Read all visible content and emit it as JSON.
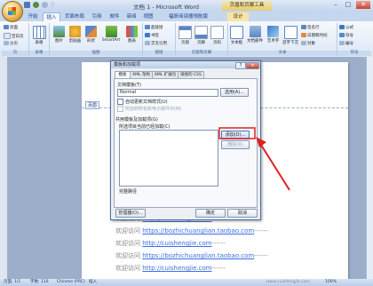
{
  "window": {
    "title": "文档 1 - Microsoft Word",
    "context_tool": "页眉和页脚工具",
    "minimize": "–",
    "maximize": "□",
    "close": "✕"
  },
  "tabs": [
    "开始",
    "插入",
    "页面布局",
    "引用",
    "邮件",
    "审阅",
    "视图",
    "福昕阅读器领航版",
    "设计"
  ],
  "ribbon": {
    "pages": {
      "label": "页",
      "items": [
        "封面",
        "空白页",
        "分页"
      ]
    },
    "table": {
      "label": "表格",
      "button": "表格"
    },
    "illustrations": {
      "label": "插图",
      "buttons": [
        "图片",
        "剪贴画",
        "形状",
        "SmartArt",
        "图表"
      ]
    },
    "links": {
      "label": "链接",
      "items": [
        "超链接",
        "书签",
        "交叉引用"
      ]
    },
    "header_footer": {
      "label": "页眉和页脚",
      "buttons": [
        "页眉",
        "页脚",
        "页码"
      ]
    },
    "text": {
      "label": "文本",
      "buttons": [
        "文本框",
        "文档部件",
        "艺术字",
        "首字下沉"
      ],
      "items": [
        "签名行",
        "日期和时间",
        "对象"
      ]
    },
    "symbols": {
      "label": "符号",
      "items": [
        "公式",
        "符号",
        "编号"
      ]
    }
  },
  "document": {
    "header_tag": "页眉",
    "lines": [
      {
        "prefix": "欢迎访问",
        "link": "http://cuishengjie.com"
      },
      {
        "prefix": "欢迎访问",
        "link": "https://bozhichuanglian.taobao.com"
      },
      {
        "prefix": "欢迎访问",
        "link": "http://cuishengjie.com"
      },
      {
        "prefix": "欢迎访问",
        "link": "https://bozhichuanglian.taobao.com"
      },
      {
        "prefix": "欢迎访问",
        "link": "http://cuishengjie.com"
      }
    ],
    "dashes": "------"
  },
  "dialog": {
    "title": "模板和加载项",
    "help": "?",
    "close": "✕",
    "tabs": [
      "模板",
      "XML 架构",
      "XML 扩展包",
      "链接的 CSS"
    ],
    "doc_template_label": "文档模板(T)",
    "doc_template_value": "Normal",
    "select_button": "选用(A)...",
    "auto_update": "自动更新文档样式(U)",
    "attach_all": "附加到所有新电子邮件中(M)",
    "global_label": "共用模板及加载项(G)",
    "global_sub": "所选项目当前已经加载(C)",
    "add_button": "添加(D)...",
    "remove_button": "删除(R)",
    "full_path_label": "完整路径",
    "organizer_button": "管理器(O)...",
    "ok_button": "确定",
    "cancel_button": "取消"
  },
  "status": {
    "page": "页面: 1/1",
    "words": "字数: 110",
    "language": "Chinese (PRC)",
    "insert": "插入",
    "zoom": "100%"
  },
  "watermark": "www.cuishengjie.com"
}
